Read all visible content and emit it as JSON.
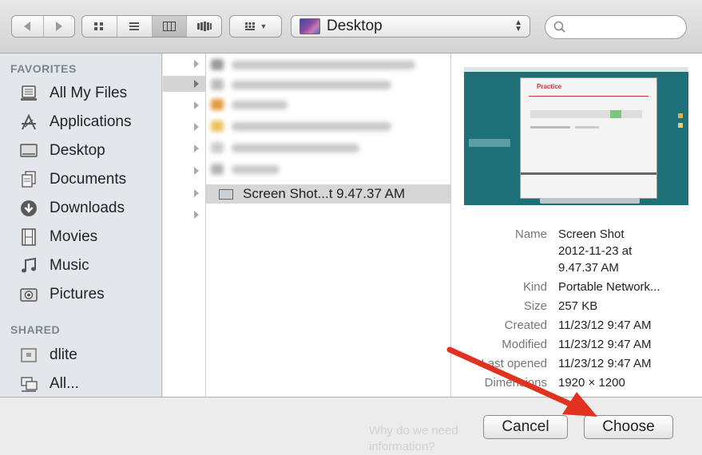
{
  "toolbar": {
    "view_modes": [
      "icon-view",
      "list-view",
      "column-view",
      "coverflow-view"
    ],
    "location": "Desktop",
    "search_placeholder": ""
  },
  "sidebar": {
    "favorites_header": "FAVORITES",
    "favorites": [
      {
        "label": "All My Files",
        "icon": "all-files-icon"
      },
      {
        "label": "Applications",
        "icon": "applications-icon"
      },
      {
        "label": "Desktop",
        "icon": "desktop-icon"
      },
      {
        "label": "Documents",
        "icon": "documents-icon"
      },
      {
        "label": "Downloads",
        "icon": "downloads-icon"
      },
      {
        "label": "Movies",
        "icon": "movies-icon"
      },
      {
        "label": "Music",
        "icon": "music-icon"
      },
      {
        "label": "Pictures",
        "icon": "pictures-icon"
      }
    ],
    "shared_header": "SHARED",
    "shared": [
      {
        "label": "dlite",
        "icon": "computer-icon"
      },
      {
        "label": "All...",
        "icon": "network-icon"
      }
    ]
  },
  "browser": {
    "selected_file": "Screen Shot...t 9.47.37 AM"
  },
  "preview": {
    "name_label": "Name",
    "name_value_1": "Screen Shot",
    "name_value_2": "2012-11-23 at",
    "name_value_3": "9.47.37 AM",
    "kind_label": "Kind",
    "kind_value": "Portable Network...",
    "size_label": "Size",
    "size_value": "257 KB",
    "created_label": "Created",
    "created_value": "11/23/12 9:47 AM",
    "modified_label": "Modified",
    "modified_value": "11/23/12 9:47 AM",
    "last_opened_label": "Last opened",
    "last_opened_value": "11/23/12 9:47 AM",
    "dimensions_label": "Dimensions",
    "dimensions_value": "1920 × 1200",
    "thumb_title": "Practice"
  },
  "buttons": {
    "cancel": "Cancel",
    "choose": "Choose"
  },
  "background_text": {
    "line1": "Why do we need",
    "line2": "information?"
  },
  "colors": {
    "annotation_arrow": "#e0321e",
    "sidebar_bg": "#e3e7ec",
    "thumb_bg": "#1d6f78"
  }
}
